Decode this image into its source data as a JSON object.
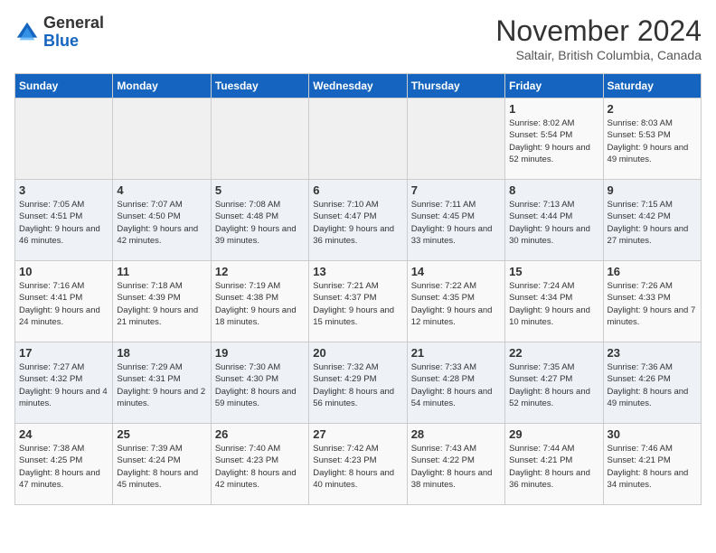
{
  "header": {
    "logo_general": "General",
    "logo_blue": "Blue",
    "month_title": "November 2024",
    "subtitle": "Saltair, British Columbia, Canada"
  },
  "days_of_week": [
    "Sunday",
    "Monday",
    "Tuesday",
    "Wednesday",
    "Thursday",
    "Friday",
    "Saturday"
  ],
  "weeks": [
    [
      {
        "day": "",
        "info": ""
      },
      {
        "day": "",
        "info": ""
      },
      {
        "day": "",
        "info": ""
      },
      {
        "day": "",
        "info": ""
      },
      {
        "day": "",
        "info": ""
      },
      {
        "day": "1",
        "info": "Sunrise: 8:02 AM\nSunset: 5:54 PM\nDaylight: 9 hours and 52 minutes."
      },
      {
        "day": "2",
        "info": "Sunrise: 8:03 AM\nSunset: 5:53 PM\nDaylight: 9 hours and 49 minutes."
      }
    ],
    [
      {
        "day": "3",
        "info": "Sunrise: 7:05 AM\nSunset: 4:51 PM\nDaylight: 9 hours and 46 minutes."
      },
      {
        "day": "4",
        "info": "Sunrise: 7:07 AM\nSunset: 4:50 PM\nDaylight: 9 hours and 42 minutes."
      },
      {
        "day": "5",
        "info": "Sunrise: 7:08 AM\nSunset: 4:48 PM\nDaylight: 9 hours and 39 minutes."
      },
      {
        "day": "6",
        "info": "Sunrise: 7:10 AM\nSunset: 4:47 PM\nDaylight: 9 hours and 36 minutes."
      },
      {
        "day": "7",
        "info": "Sunrise: 7:11 AM\nSunset: 4:45 PM\nDaylight: 9 hours and 33 minutes."
      },
      {
        "day": "8",
        "info": "Sunrise: 7:13 AM\nSunset: 4:44 PM\nDaylight: 9 hours and 30 minutes."
      },
      {
        "day": "9",
        "info": "Sunrise: 7:15 AM\nSunset: 4:42 PM\nDaylight: 9 hours and 27 minutes."
      }
    ],
    [
      {
        "day": "10",
        "info": "Sunrise: 7:16 AM\nSunset: 4:41 PM\nDaylight: 9 hours and 24 minutes."
      },
      {
        "day": "11",
        "info": "Sunrise: 7:18 AM\nSunset: 4:39 PM\nDaylight: 9 hours and 21 minutes."
      },
      {
        "day": "12",
        "info": "Sunrise: 7:19 AM\nSunset: 4:38 PM\nDaylight: 9 hours and 18 minutes."
      },
      {
        "day": "13",
        "info": "Sunrise: 7:21 AM\nSunset: 4:37 PM\nDaylight: 9 hours and 15 minutes."
      },
      {
        "day": "14",
        "info": "Sunrise: 7:22 AM\nSunset: 4:35 PM\nDaylight: 9 hours and 12 minutes."
      },
      {
        "day": "15",
        "info": "Sunrise: 7:24 AM\nSunset: 4:34 PM\nDaylight: 9 hours and 10 minutes."
      },
      {
        "day": "16",
        "info": "Sunrise: 7:26 AM\nSunset: 4:33 PM\nDaylight: 9 hours and 7 minutes."
      }
    ],
    [
      {
        "day": "17",
        "info": "Sunrise: 7:27 AM\nSunset: 4:32 PM\nDaylight: 9 hours and 4 minutes."
      },
      {
        "day": "18",
        "info": "Sunrise: 7:29 AM\nSunset: 4:31 PM\nDaylight: 9 hours and 2 minutes."
      },
      {
        "day": "19",
        "info": "Sunrise: 7:30 AM\nSunset: 4:30 PM\nDaylight: 8 hours and 59 minutes."
      },
      {
        "day": "20",
        "info": "Sunrise: 7:32 AM\nSunset: 4:29 PM\nDaylight: 8 hours and 56 minutes."
      },
      {
        "day": "21",
        "info": "Sunrise: 7:33 AM\nSunset: 4:28 PM\nDaylight: 8 hours and 54 minutes."
      },
      {
        "day": "22",
        "info": "Sunrise: 7:35 AM\nSunset: 4:27 PM\nDaylight: 8 hours and 52 minutes."
      },
      {
        "day": "23",
        "info": "Sunrise: 7:36 AM\nSunset: 4:26 PM\nDaylight: 8 hours and 49 minutes."
      }
    ],
    [
      {
        "day": "24",
        "info": "Sunrise: 7:38 AM\nSunset: 4:25 PM\nDaylight: 8 hours and 47 minutes."
      },
      {
        "day": "25",
        "info": "Sunrise: 7:39 AM\nSunset: 4:24 PM\nDaylight: 8 hours and 45 minutes."
      },
      {
        "day": "26",
        "info": "Sunrise: 7:40 AM\nSunset: 4:23 PM\nDaylight: 8 hours and 42 minutes."
      },
      {
        "day": "27",
        "info": "Sunrise: 7:42 AM\nSunset: 4:23 PM\nDaylight: 8 hours and 40 minutes."
      },
      {
        "day": "28",
        "info": "Sunrise: 7:43 AM\nSunset: 4:22 PM\nDaylight: 8 hours and 38 minutes."
      },
      {
        "day": "29",
        "info": "Sunrise: 7:44 AM\nSunset: 4:21 PM\nDaylight: 8 hours and 36 minutes."
      },
      {
        "day": "30",
        "info": "Sunrise: 7:46 AM\nSunset: 4:21 PM\nDaylight: 8 hours and 34 minutes."
      }
    ]
  ]
}
